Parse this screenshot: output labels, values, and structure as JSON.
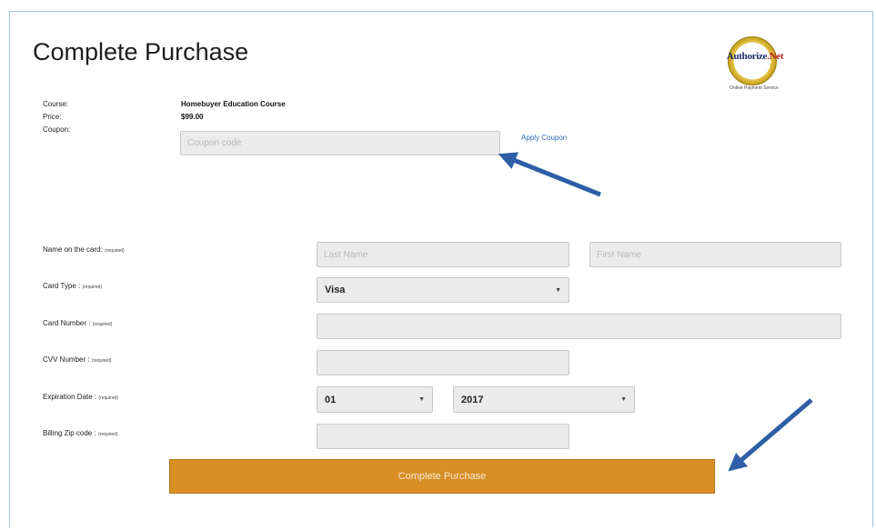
{
  "page": {
    "title": "Complete Purchase"
  },
  "logo": {
    "brand_a": "Authorize",
    "brand_b": ".Net",
    "tagline": "Online Payment Service"
  },
  "summary": {
    "course_label": "Course:",
    "course_value": "Homebuyer Education Course",
    "price_label": "Price:",
    "price_value": "$99.00",
    "coupon_label": "Coupon:",
    "coupon_placeholder": "Coupon code",
    "apply_coupon": "Apply Coupon"
  },
  "form": {
    "name_label": "Name on the card:",
    "name_req": "(required)",
    "last_name_placeholder": "Last Name",
    "first_name_placeholder": "First Name",
    "card_type_label": "Card Type :",
    "card_type_req": "(required)",
    "card_type_value": "Visa",
    "card_number_label": "Card Number :",
    "card_number_req": "(required)",
    "cvv_label": "CVV Number :",
    "cvv_req": "(required)",
    "expiration_label": "Expiration Date :",
    "expiration_req": "(required)",
    "exp_month_value": "01",
    "exp_year_value": "2017",
    "zip_label": "Billing Zip code :",
    "zip_req": "(required)",
    "submit_label": "Complete Purchase"
  },
  "colors": {
    "button": "#d98f23",
    "arrow": "#2e5fa6",
    "link": "#2f6bb3"
  },
  "icons": {
    "select_caret": "chevron-down-icon",
    "annotation": "arrow-icon"
  }
}
